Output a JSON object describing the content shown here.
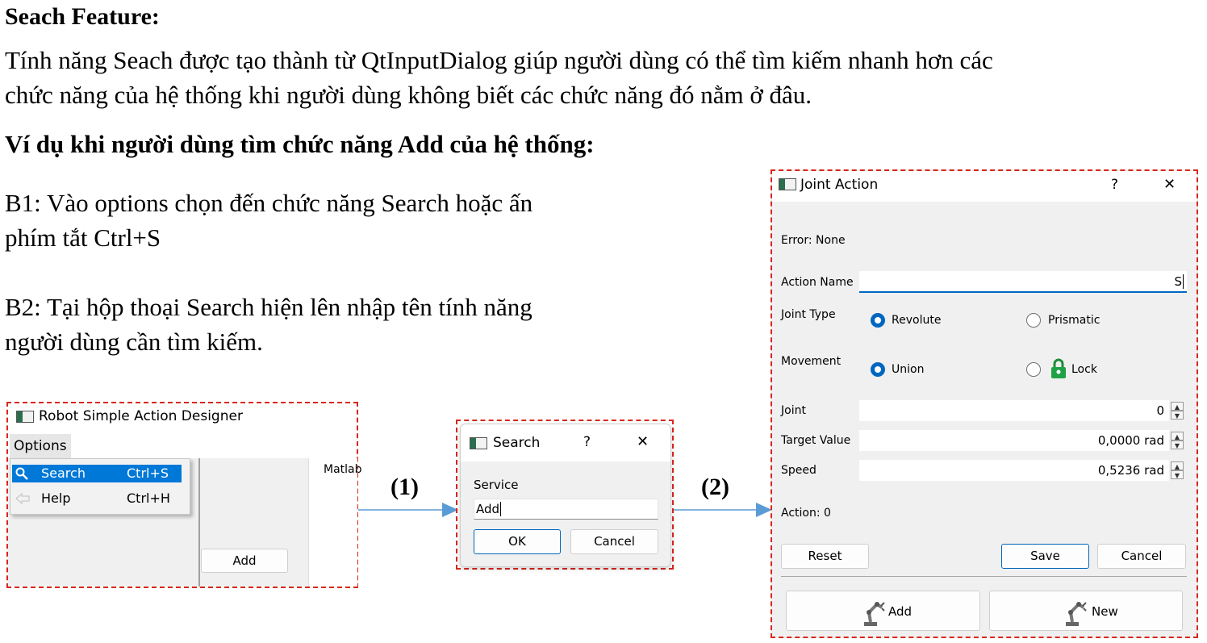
{
  "doc": {
    "heading": "Seach Feature:",
    "intro_line1": "Tính năng Seach được tạo thành từ QtInputDialog giúp người dùng có thể tìm kiếm nhanh hơn các",
    "intro_line2": "chức năng của hệ thống khi người dùng không biết các chức năng đó nằm ở đâu.",
    "example_heading": "Ví dụ khi người dùng tìm chức năng Add của hệ thống:",
    "step1_line1": "B1: Vào options chọn đến chức năng Search hoặc ấn",
    "step1_line2": "phím tắt Ctrl+S",
    "step2_line1": "B2: Tại hộp thoại Search hiện lên nhập tên tính năng",
    "step2_line2": "người dùng cần tìm kiếm.",
    "arrow1_label": "(1)",
    "arrow2_label": "(2)",
    "frame_color": "#d9261c",
    "arrow_color": "#5b9bd5"
  },
  "main_window": {
    "title": "Robot Simple Action Designer",
    "menu_options": "Options",
    "menu_items": [
      {
        "label": "Search",
        "shortcut": "Ctrl+S",
        "icon": "search-icon",
        "highlighted": true
      },
      {
        "label": "Help",
        "shortcut": "Ctrl+H",
        "icon": "help-arrow-icon",
        "highlighted": false
      }
    ],
    "tab_label": "Matlab",
    "add_button": "Add"
  },
  "search_dialog": {
    "title": "Search",
    "help_glyph": "?",
    "close_glyph": "✕",
    "field_label": "Service",
    "input_value": "Add",
    "ok_button": "OK",
    "cancel_button": "Cancel"
  },
  "joint_dialog": {
    "title": "Joint Action",
    "help_glyph": "?",
    "close_glyph": "✕",
    "error_text": "Error: None",
    "action_name_label": "Action Name",
    "action_name_value": "S",
    "joint_type_label": "Joint Type",
    "joint_type_options": [
      {
        "label": "Revolute",
        "selected": true
      },
      {
        "label": "Prismatic",
        "selected": false
      }
    ],
    "movement_label": "Movement",
    "movement_options": [
      {
        "label": "Union",
        "selected": true
      },
      {
        "label": "Lock",
        "selected": false,
        "icon": "padlock-icon"
      }
    ],
    "joint_label": "Joint",
    "joint_value": "0",
    "target_label": "Target Value",
    "target_value": "0,0000 rad",
    "speed_label": "Speed",
    "speed_value": "0,5236 rad",
    "action_count_text": "Action: 0",
    "reset_button": "Reset",
    "save_button": "Save",
    "cancel_button": "Cancel",
    "add_button": "Add",
    "new_button": "New",
    "accent_color": "#0067c0"
  }
}
